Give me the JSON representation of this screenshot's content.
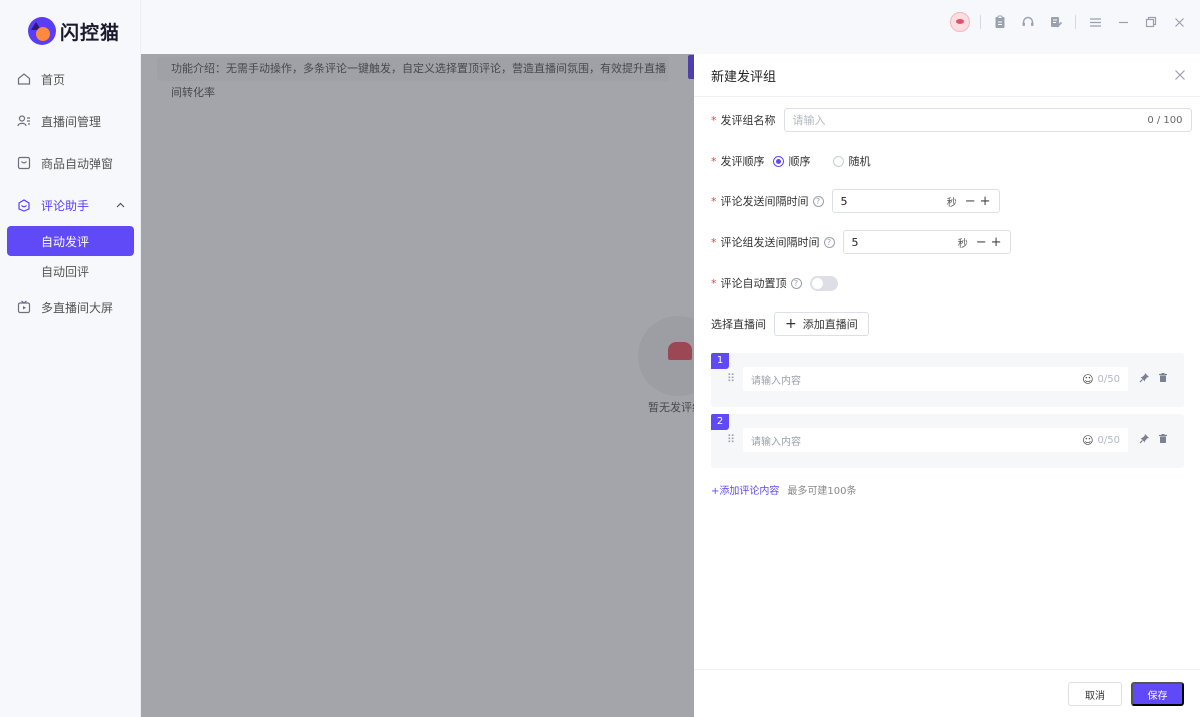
{
  "app": {
    "name": "闪控猫",
    "logo_icon": "cat-logo-icon"
  },
  "sidebar": {
    "items": [
      {
        "label": "首页",
        "icon": "home-icon"
      },
      {
        "label": "直播间管理",
        "icon": "user-list-icon"
      },
      {
        "label": "商品自动弹窗",
        "icon": "popup-window-icon"
      },
      {
        "label": "评论助手",
        "icon": "comment-helper-icon",
        "expanded": true,
        "children": [
          {
            "label": "自动发评",
            "active": true
          },
          {
            "label": "自动回评"
          }
        ]
      },
      {
        "label": "多直播间大屏",
        "icon": "tv-screen-icon"
      }
    ]
  },
  "topbar": {
    "icons": [
      "avatar-icon",
      "clipboard-icon",
      "headset-icon",
      "edit-note-icon",
      "menu-icon",
      "minimize-icon",
      "restore-icon",
      "close-icon"
    ]
  },
  "main": {
    "intro": "功能介绍：无需手动操作，多条评论一键触发，自定义选择置顶评论，营造直播间氛围，有效提升直播间转化率",
    "empty_text": "暂无发评组"
  },
  "drawer": {
    "title": "新建发评组",
    "name_label": "发评组名称",
    "name_placeholder": "请输入",
    "name_count": "0 / 100",
    "order_label": "发评顺序",
    "order_options": [
      "顺序",
      "随机"
    ],
    "order_selected": "顺序",
    "interval_label": "评论发送间隔时间",
    "interval_value": "5",
    "group_interval_label": "评论组发送间隔时间",
    "group_interval_value": "5",
    "unit": "秒",
    "autopin_label": "评论自动置顶",
    "autopin_on": false,
    "room_label": "选择直播间",
    "add_room": "添加直播间",
    "comments": [
      {
        "index": "1",
        "placeholder": "请输入内容",
        "count": "0/50"
      },
      {
        "index": "2",
        "placeholder": "请输入内容",
        "count": "0/50"
      }
    ],
    "add_comment": "添加评论内容",
    "add_comment_hint": "最多可建100条",
    "cancel": "取消",
    "save": "保存"
  },
  "colors": {
    "accent": "#6049f6",
    "required": "#e8423c",
    "overlay": "rgba(50,52,60,0.4)"
  }
}
